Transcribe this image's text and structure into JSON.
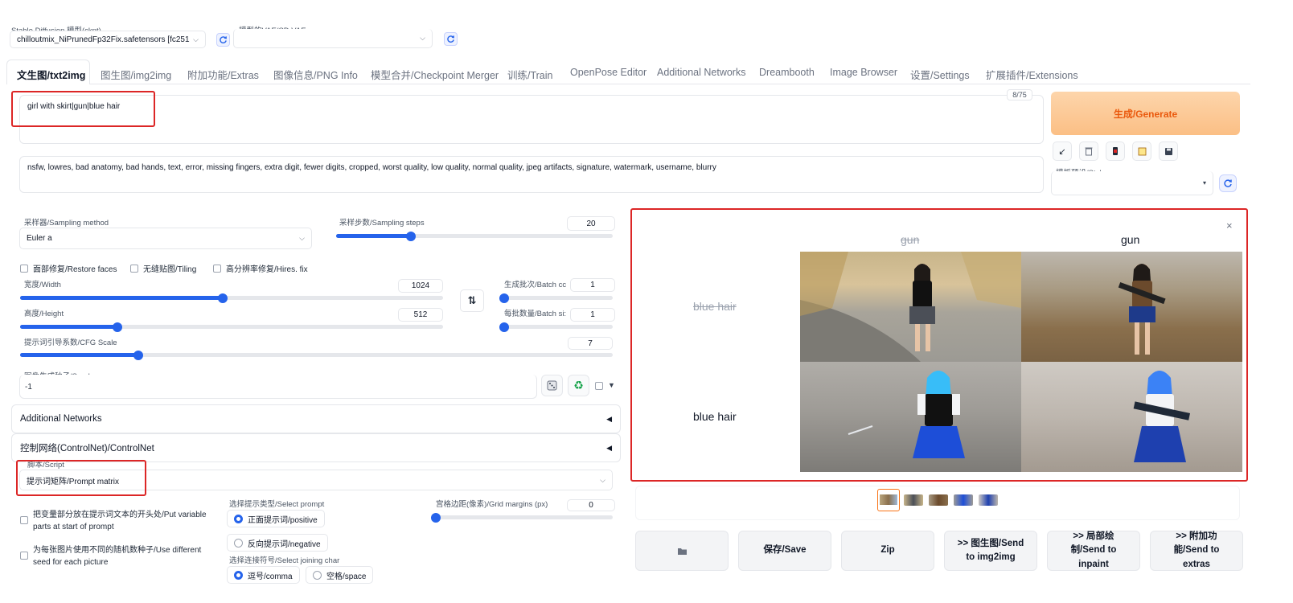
{
  "model": {
    "ckpt_label": "Stable Diffusion 模型(ckpt)",
    "ckpt_value": "chilloutmix_NiPrunedFp32Fix.safetensors [fc251",
    "vae_label": "模型的VAE/SD VAE",
    "vae_value": ""
  },
  "tabs": [
    "文生图/txt2img",
    "图生图/img2img",
    "附加功能/Extras",
    "图像信息/PNG Info",
    "模型合并/Checkpoint Merger",
    "训练/Train",
    "OpenPose Editor",
    "Additional Networks",
    "Dreambooth",
    "Image Browser",
    "设置/Settings",
    "扩展插件/Extensions"
  ],
  "prompt": {
    "positive": "girl with skirt|gun|blue hair",
    "token_count": "8/75",
    "negative": "nsfw, lowres, bad anatomy, bad hands, text, error, missing fingers, extra digit, fewer digits, cropped, worst quality, low quality, normal quality, jpeg artifacts, signature, watermark, username, blurry"
  },
  "generate_label": "生成/Generate",
  "styles_label": "模板预设/Styles",
  "params": {
    "sampler_label": "采样器/Sampling method",
    "sampler_value": "Euler a",
    "steps_label": "采样步数/Sampling steps",
    "steps_value": "20",
    "steps_fraction": 0.27,
    "restore_faces": "面部修复/Restore faces",
    "tiling": "无缝贴图/Tiling",
    "hires": "高分辨率修复/Hires. fix",
    "width_label": "宽度/Width",
    "width_value": "1024",
    "width_fraction": 0.48,
    "height_label": "高度/Height",
    "height_value": "512",
    "height_fraction": 0.23,
    "batch_count_label": "生成批次/Batch cc",
    "batch_count_value": "1",
    "batch_size_label": "每批数量/Batch si:",
    "batch_size_value": "1",
    "cfg_label": "提示词引导系数/CFG Scale",
    "cfg_value": "7",
    "cfg_fraction": 0.2,
    "seed_label": "图像生成种子/Seed",
    "seed_value": "-1"
  },
  "accordions": {
    "additional_networks": "Additional Networks",
    "controlnet": "控制网络(ControlNet)/ControlNet"
  },
  "script": {
    "label": "脚本/Script",
    "value": "提示词矩阵/Prompt matrix",
    "put_variable_start": "把变量部分放在提示词文本的开头处/Put variable parts at start of prompt",
    "different_seed": "为每张图片使用不同的随机数种子/Use different seed for each picture",
    "select_prompt_label": "选择提示类型/Select prompt",
    "positive_option": "正面提示词/positive",
    "negative_option": "反向提示词/negative",
    "joining_label": "选择连接符号/Select joining char",
    "comma_option": "逗号/comma",
    "space_option": "空格/space",
    "margins_label": "宫格边距(像素)/Grid margins (px)",
    "margins_value": "0"
  },
  "gallery": {
    "col_headers": [
      "gun",
      "gun"
    ],
    "row_headers": [
      "blue hair",
      "blue hair"
    ],
    "close": "×"
  },
  "actions": {
    "save": "保存/Save",
    "zip": "Zip",
    "send_img2img": ">> 图生图/Send to img2img",
    "send_inpaint": ">> 局部绘制/Send to inpaint",
    "send_extras": ">> 附加功能/Send to extras"
  }
}
